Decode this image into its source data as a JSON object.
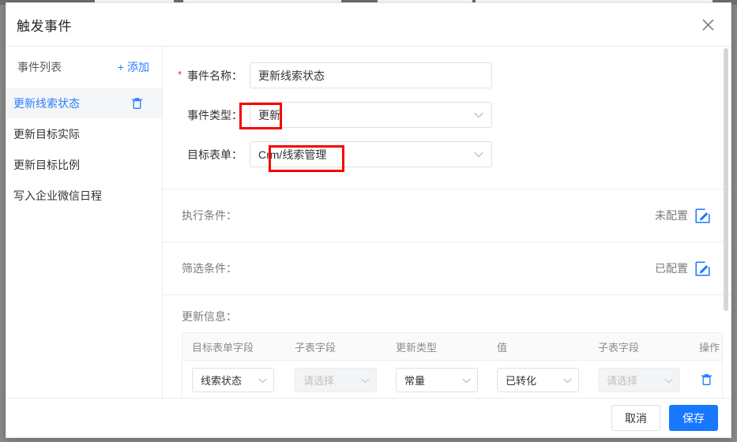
{
  "modal": {
    "title": "触发事件",
    "close_icon": "close-icon"
  },
  "sidebar": {
    "header": {
      "title": "事件列表",
      "add_plus": "+",
      "add_label": "添加"
    },
    "items": [
      {
        "label": "更新线索状态",
        "active": true,
        "has_delete": true
      },
      {
        "label": "更新目标实际",
        "active": false,
        "has_delete": false
      },
      {
        "label": "更新目标比例",
        "active": false,
        "has_delete": false
      },
      {
        "label": "写入企业微信日程",
        "active": false,
        "has_delete": false
      }
    ]
  },
  "form": {
    "name_required_marker": "*",
    "name_label": "事件名称：",
    "name_value": "更新线索状态",
    "type_label": "事件类型：",
    "type_value": "更新",
    "target_form_label": "目标表单：",
    "target_form_value": "Crm/线索管理"
  },
  "conditions": [
    {
      "label": "执行条件：",
      "status": "未配置",
      "edit_icon": "edit-icon"
    },
    {
      "label": "筛选条件：",
      "status": "已配置",
      "edit_icon": "edit-icon"
    }
  ],
  "update_info": {
    "title": "更新信息：",
    "columns": [
      "目标表单字段",
      "子表字段",
      "更新类型",
      "值",
      "子表字段",
      "操作"
    ],
    "rows": [
      {
        "target_field": "线索状态",
        "sub_field_1": "请选择",
        "update_type": "常量",
        "value": "已转化",
        "sub_field_2": "请选择",
        "delete_icon": "trash-icon"
      }
    ]
  },
  "footer": {
    "cancel_label": "取消",
    "save_label": "保存"
  },
  "colors": {
    "primary": "#1677ff",
    "link": "#2b7cff",
    "annotation": "#f70000",
    "required": "#f5222d",
    "muted_text": "#7a7a7a"
  }
}
